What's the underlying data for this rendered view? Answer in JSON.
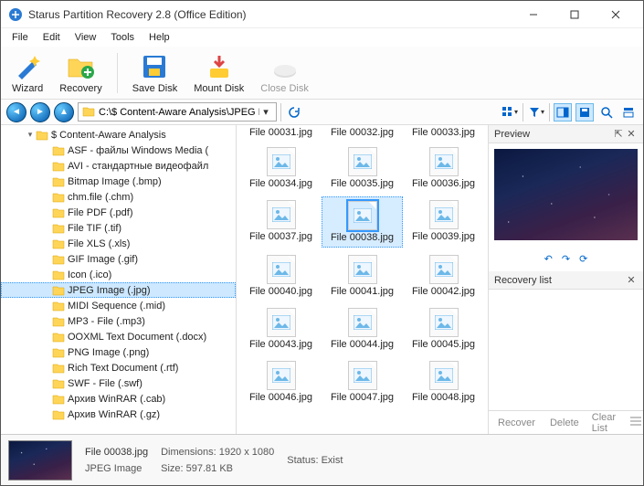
{
  "window": {
    "title": "Starus Partition Recovery 2.8 (Office Edition)"
  },
  "menu": {
    "items": [
      "File",
      "Edit",
      "View",
      "Tools",
      "Help"
    ]
  },
  "toolbar": {
    "wizard": "Wizard",
    "recovery": "Recovery",
    "save_disk": "Save Disk",
    "mount_disk": "Mount Disk",
    "close_disk": "Close Disk"
  },
  "address": {
    "path": "C:\\$ Content-Aware Analysis\\JPEG Image (.jpg)"
  },
  "tree": {
    "root": "$ Content-Aware Analysis",
    "items": [
      "ASF - файлы Windows Media (",
      "AVI - стандартные видеофайл",
      "Bitmap Image (.bmp)",
      "chm.file (.chm)",
      "File PDF (.pdf)",
      "File TIF (.tif)",
      "File XLS (.xls)",
      "GIF Image (.gif)",
      "Icon (.ico)",
      "JPEG Image (.jpg)",
      "MIDI Sequence (.mid)",
      "MP3 - File (.mp3)",
      "OOXML Text Document (.docx)",
      "PNG Image (.png)",
      "Rich Text Document (.rtf)",
      "SWF - File (.swf)",
      "Архив WinRAR (.cab)",
      "Архив WinRAR (.gz)"
    ],
    "selected_index": 9
  },
  "files": {
    "row_top": [
      "File 00031.jpg",
      "File 00032.jpg",
      "File 00033.jpg"
    ],
    "grid": [
      "File 00034.jpg",
      "File 00035.jpg",
      "File 00036.jpg",
      "File 00037.jpg",
      "File 00038.jpg",
      "File 00039.jpg",
      "File 00040.jpg",
      "File 00041.jpg",
      "File 00042.jpg",
      "File 00043.jpg",
      "File 00044.jpg",
      "File 00045.jpg",
      "File 00046.jpg",
      "File 00047.jpg",
      "File 00048.jpg"
    ],
    "selected": "File 00038.jpg"
  },
  "side": {
    "preview_label": "Preview",
    "recovery_list_label": "Recovery list",
    "recover": "Recover",
    "delete": "Delete",
    "clear": "Clear List"
  },
  "status": {
    "filename": "File 00038.jpg",
    "filetype": "JPEG Image",
    "dim_label": "Dimensions:",
    "dim_value": "1920 x 1080",
    "size_label": "Size:",
    "size_value": "597.81 KB",
    "status_label": "Status:",
    "status_value": "Exist"
  }
}
